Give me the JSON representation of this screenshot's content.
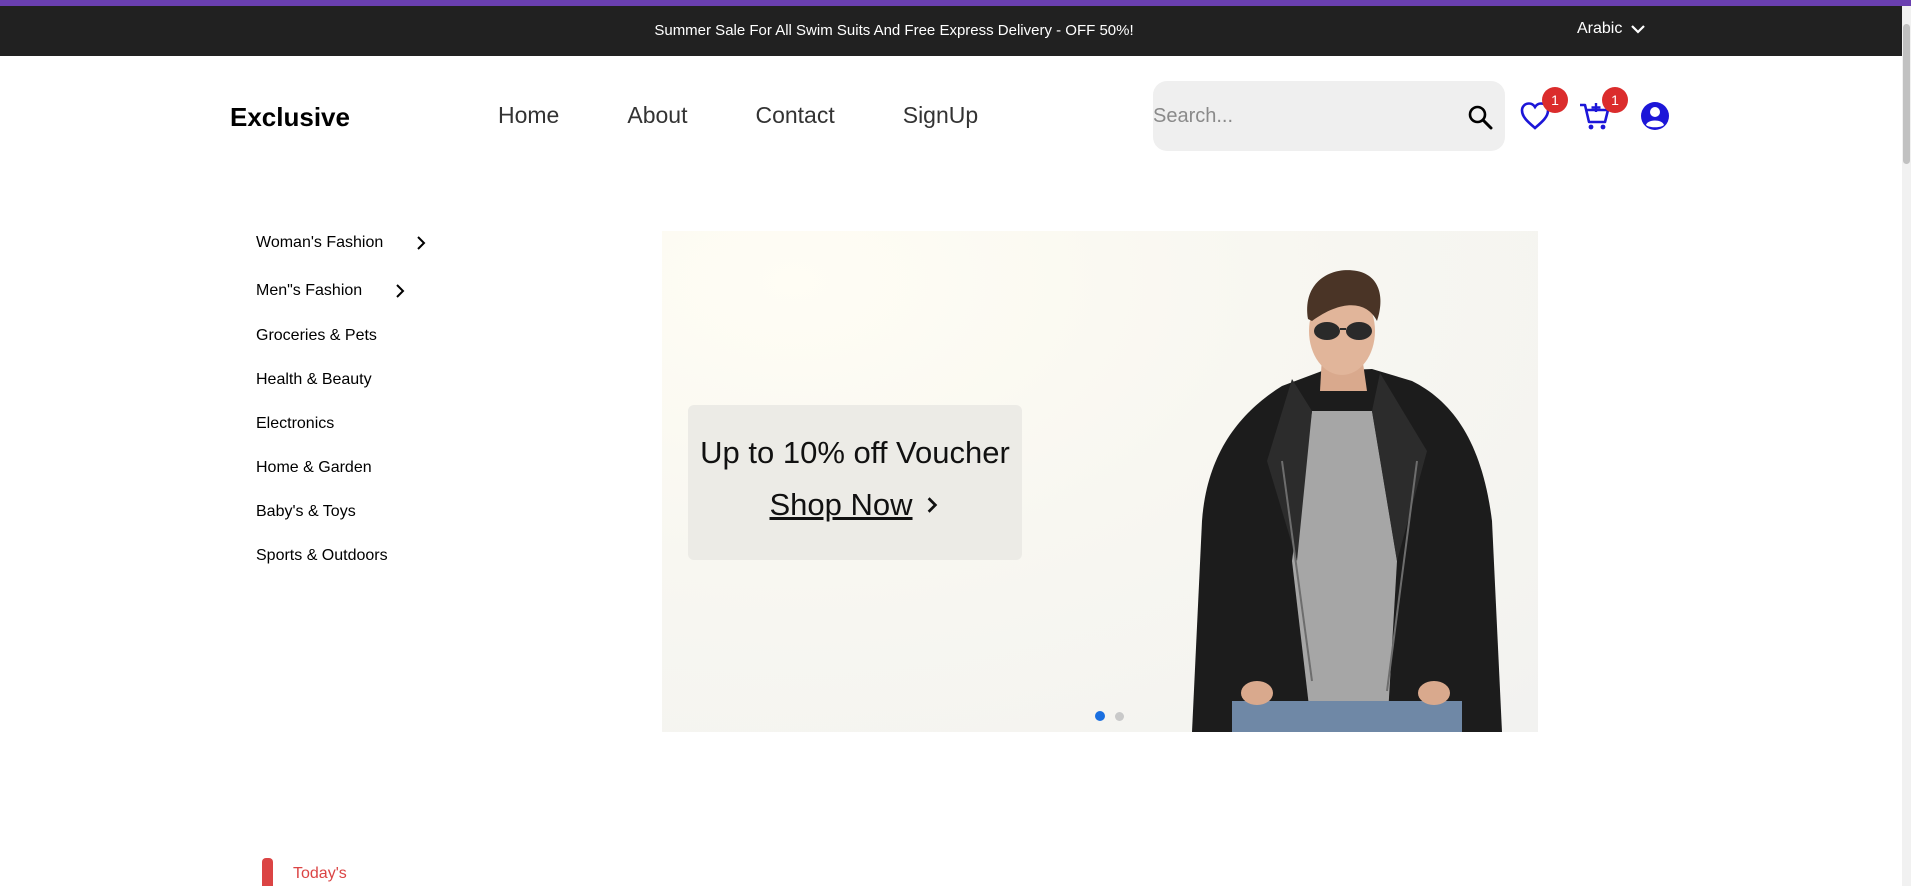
{
  "topbar": {
    "promo": "Summer Sale For All Swim Suits And Free Express Delivery - OFF 50%!",
    "language": "Arabic"
  },
  "header": {
    "logo": "Exclusive",
    "nav": [
      "Home",
      "About",
      "Contact",
      "SignUp"
    ],
    "search_placeholder": "Search...",
    "wishlist_count": "1",
    "cart_count": "1"
  },
  "sidebar": {
    "items": [
      "Woman's Fashion",
      "Men\"s Fashion",
      "Groceries & Pets",
      "Health & Beauty",
      "Electronics",
      "Home & Garden",
      "Baby's & Toys",
      "Sports & Outdoors"
    ]
  },
  "banner": {
    "headline": "Up to 10% off Voucher",
    "cta": "Shop Now",
    "slides_total": 2,
    "active_slide": 1
  },
  "section": {
    "label": "Today's"
  },
  "colors": {
    "accent": "#db4444",
    "topbar_bg": "#212121",
    "icon_blue": "#1c16d8",
    "badge": "#db2c2c",
    "active_dot": "#1a6fe0"
  },
  "icons": [
    "chevron-down-icon",
    "search-icon",
    "heart-icon",
    "cart-icon",
    "user-icon",
    "chevron-right-icon"
  ]
}
